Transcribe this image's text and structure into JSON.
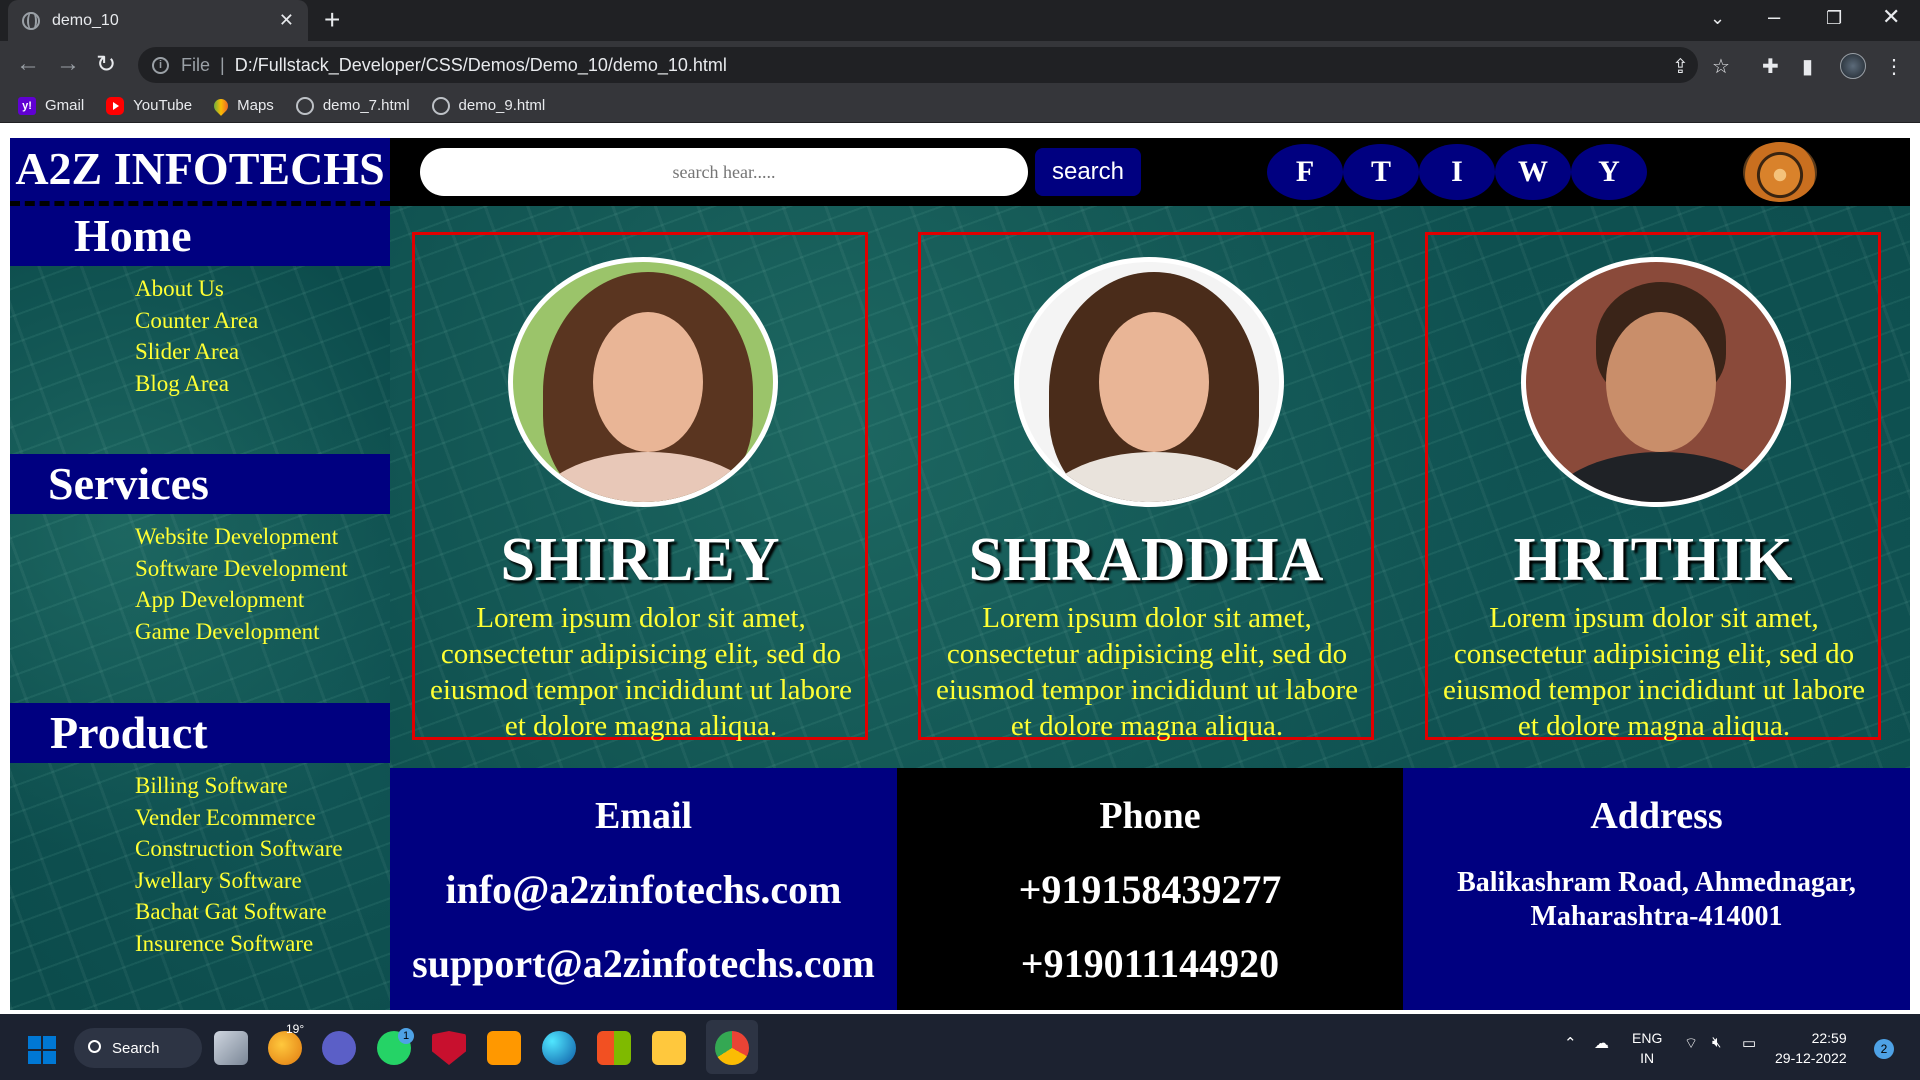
{
  "browser": {
    "tab_title": "demo_10",
    "tab_close": "✕",
    "new_tab": "+",
    "omnibox_file": "File",
    "omnibox_sep": "|",
    "url": "D:/Fullstack_Developer/CSS/Demos/Demo_10/demo_10.html",
    "bookmarks": [
      "Gmail",
      "YouTube",
      "Maps",
      "demo_7.html",
      "demo_9.html"
    ]
  },
  "site": {
    "brand": "A2Z INFOTECHS",
    "search_placeholder": "search hear.....",
    "search_button": "search",
    "social": [
      "F",
      "T",
      "I",
      "W",
      "Y"
    ]
  },
  "sidebar": {
    "sections": [
      {
        "title": "Home",
        "links": [
          "About Us",
          "Counter Area",
          "Slider Area",
          "Blog Area"
        ]
      },
      {
        "title": "Services",
        "links": [
          "Website Development",
          "Software Development",
          "App Development",
          "Game Development"
        ]
      },
      {
        "title": "Product",
        "links": [
          "Billing Software",
          "Vender Ecommerce",
          "Construction Software",
          "Jwellary Software",
          "Bachat Gat Software",
          "Insurence Software"
        ]
      }
    ]
  },
  "cards": [
    {
      "name": "SHIRLEY",
      "text": "Lorem ipsum dolor sit amet, consectetur adipisicing elit, sed do eiusmod tempor incididunt ut labore et dolore magna aliqua."
    },
    {
      "name": "SHRADDHA",
      "text": "Lorem ipsum dolor sit amet, consectetur adipisicing elit, sed do eiusmod tempor incididunt ut labore et dolore magna aliqua."
    },
    {
      "name": "HRITHIK",
      "text": "Lorem ipsum dolor sit amet, consectetur adipisicing elit, sed do eiusmod tempor incididunt ut labore et dolore magna aliqua."
    }
  ],
  "contact": {
    "email_title": "Email",
    "email_1": "info@a2zinfotechs.com",
    "email_2": "support@a2zinfotechs.com",
    "phone_title": "Phone",
    "phone_1": "+919158439277",
    "phone_2": "+919011144920",
    "address_title": "Address",
    "address_line_1": "Balikashram Road, Ahmednagar,",
    "address_line_2": "Maharashtra-414001"
  },
  "taskbar": {
    "search": "Search",
    "weather": "19°",
    "whatsapp_badge": "1",
    "lang_1": "ENG",
    "lang_2": "IN",
    "time": "22:59",
    "date": "29-12-2022",
    "notifications": "2"
  },
  "colors": {
    "navy": "#000080",
    "link_yellow": "#ffff33",
    "card_border": "#e00000",
    "hero_teal": "#0c4c4c"
  }
}
